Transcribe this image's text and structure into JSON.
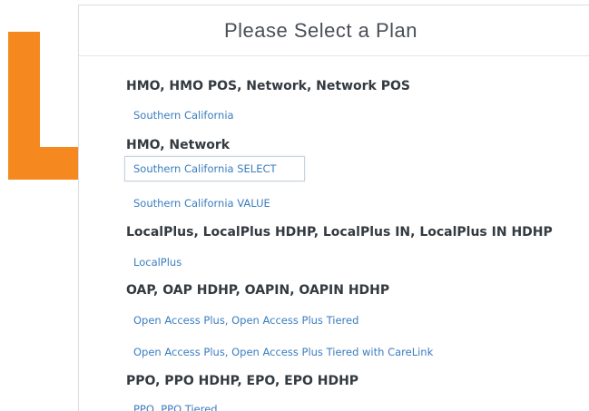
{
  "dialog": {
    "title": "Please Select a Plan"
  },
  "plan_groups": [
    {
      "heading": "HMO, HMO POS, Network, Network POS",
      "plans": [
        "Southern California"
      ]
    },
    {
      "heading": "HMO, Network",
      "plans": [
        "Southern California SELECT",
        "Southern California VALUE"
      ]
    },
    {
      "heading": "LocalPlus, LocalPlus HDHP, LocalPlus IN, LocalPlus IN HDHP",
      "plans": [
        "LocalPlus"
      ]
    },
    {
      "heading": "OAP, OAP HDHP, OAPIN, OAPIN HDHP",
      "plans": [
        "Open Access Plus, Open Access Plus Tiered",
        "Open Access Plus, Open Access Plus Tiered with CareLink"
      ]
    },
    {
      "heading": "PPO, PPO HDHP, EPO, EPO HDHP",
      "plans": [
        "PPO, PPO Tiered"
      ]
    }
  ],
  "highlighted_plan": "Southern California SELECT",
  "colors": {
    "annotation": "#f5891f",
    "link": "#3a7dbf",
    "heading": "#333a40",
    "title": "#4a4f55"
  },
  "icons": {
    "annotation": "arrow-right-icon"
  }
}
